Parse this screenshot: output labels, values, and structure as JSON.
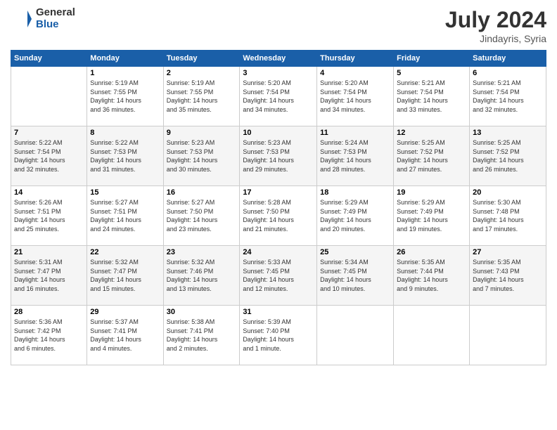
{
  "header": {
    "logo_general": "General",
    "logo_blue": "Blue",
    "month_year": "July 2024",
    "location": "Jindayris, Syria"
  },
  "days_of_week": [
    "Sunday",
    "Monday",
    "Tuesday",
    "Wednesday",
    "Thursday",
    "Friday",
    "Saturday"
  ],
  "weeks": [
    [
      {
        "day": "",
        "info": ""
      },
      {
        "day": "1",
        "info": "Sunrise: 5:19 AM\nSunset: 7:55 PM\nDaylight: 14 hours\nand 36 minutes."
      },
      {
        "day": "2",
        "info": "Sunrise: 5:19 AM\nSunset: 7:55 PM\nDaylight: 14 hours\nand 35 minutes."
      },
      {
        "day": "3",
        "info": "Sunrise: 5:20 AM\nSunset: 7:54 PM\nDaylight: 14 hours\nand 34 minutes."
      },
      {
        "day": "4",
        "info": "Sunrise: 5:20 AM\nSunset: 7:54 PM\nDaylight: 14 hours\nand 34 minutes."
      },
      {
        "day": "5",
        "info": "Sunrise: 5:21 AM\nSunset: 7:54 PM\nDaylight: 14 hours\nand 33 minutes."
      },
      {
        "day": "6",
        "info": "Sunrise: 5:21 AM\nSunset: 7:54 PM\nDaylight: 14 hours\nand 32 minutes."
      }
    ],
    [
      {
        "day": "7",
        "info": "Sunrise: 5:22 AM\nSunset: 7:54 PM\nDaylight: 14 hours\nand 32 minutes."
      },
      {
        "day": "8",
        "info": "Sunrise: 5:22 AM\nSunset: 7:53 PM\nDaylight: 14 hours\nand 31 minutes."
      },
      {
        "day": "9",
        "info": "Sunrise: 5:23 AM\nSunset: 7:53 PM\nDaylight: 14 hours\nand 30 minutes."
      },
      {
        "day": "10",
        "info": "Sunrise: 5:23 AM\nSunset: 7:53 PM\nDaylight: 14 hours\nand 29 minutes."
      },
      {
        "day": "11",
        "info": "Sunrise: 5:24 AM\nSunset: 7:53 PM\nDaylight: 14 hours\nand 28 minutes."
      },
      {
        "day": "12",
        "info": "Sunrise: 5:25 AM\nSunset: 7:52 PM\nDaylight: 14 hours\nand 27 minutes."
      },
      {
        "day": "13",
        "info": "Sunrise: 5:25 AM\nSunset: 7:52 PM\nDaylight: 14 hours\nand 26 minutes."
      }
    ],
    [
      {
        "day": "14",
        "info": "Sunrise: 5:26 AM\nSunset: 7:51 PM\nDaylight: 14 hours\nand 25 minutes."
      },
      {
        "day": "15",
        "info": "Sunrise: 5:27 AM\nSunset: 7:51 PM\nDaylight: 14 hours\nand 24 minutes."
      },
      {
        "day": "16",
        "info": "Sunrise: 5:27 AM\nSunset: 7:50 PM\nDaylight: 14 hours\nand 23 minutes."
      },
      {
        "day": "17",
        "info": "Sunrise: 5:28 AM\nSunset: 7:50 PM\nDaylight: 14 hours\nand 21 minutes."
      },
      {
        "day": "18",
        "info": "Sunrise: 5:29 AM\nSunset: 7:49 PM\nDaylight: 14 hours\nand 20 minutes."
      },
      {
        "day": "19",
        "info": "Sunrise: 5:29 AM\nSunset: 7:49 PM\nDaylight: 14 hours\nand 19 minutes."
      },
      {
        "day": "20",
        "info": "Sunrise: 5:30 AM\nSunset: 7:48 PM\nDaylight: 14 hours\nand 17 minutes."
      }
    ],
    [
      {
        "day": "21",
        "info": "Sunrise: 5:31 AM\nSunset: 7:47 PM\nDaylight: 14 hours\nand 16 minutes."
      },
      {
        "day": "22",
        "info": "Sunrise: 5:32 AM\nSunset: 7:47 PM\nDaylight: 14 hours\nand 15 minutes."
      },
      {
        "day": "23",
        "info": "Sunrise: 5:32 AM\nSunset: 7:46 PM\nDaylight: 14 hours\nand 13 minutes."
      },
      {
        "day": "24",
        "info": "Sunrise: 5:33 AM\nSunset: 7:45 PM\nDaylight: 14 hours\nand 12 minutes."
      },
      {
        "day": "25",
        "info": "Sunrise: 5:34 AM\nSunset: 7:45 PM\nDaylight: 14 hours\nand 10 minutes."
      },
      {
        "day": "26",
        "info": "Sunrise: 5:35 AM\nSunset: 7:44 PM\nDaylight: 14 hours\nand 9 minutes."
      },
      {
        "day": "27",
        "info": "Sunrise: 5:35 AM\nSunset: 7:43 PM\nDaylight: 14 hours\nand 7 minutes."
      }
    ],
    [
      {
        "day": "28",
        "info": "Sunrise: 5:36 AM\nSunset: 7:42 PM\nDaylight: 14 hours\nand 6 minutes."
      },
      {
        "day": "29",
        "info": "Sunrise: 5:37 AM\nSunset: 7:41 PM\nDaylight: 14 hours\nand 4 minutes."
      },
      {
        "day": "30",
        "info": "Sunrise: 5:38 AM\nSunset: 7:41 PM\nDaylight: 14 hours\nand 2 minutes."
      },
      {
        "day": "31",
        "info": "Sunrise: 5:39 AM\nSunset: 7:40 PM\nDaylight: 14 hours\nand 1 minute."
      },
      {
        "day": "",
        "info": ""
      },
      {
        "day": "",
        "info": ""
      },
      {
        "day": "",
        "info": ""
      }
    ]
  ]
}
